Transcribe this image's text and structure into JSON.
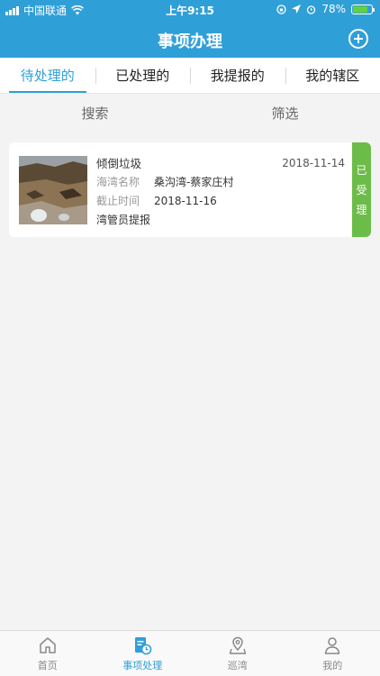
{
  "statusbar": {
    "carrier": "中国联通",
    "time": "上午9:15",
    "battery": "78%",
    "battery_level": 0.78
  },
  "navbar": {
    "title": "事项办理"
  },
  "tabs": [
    {
      "label": "待处理的",
      "active": true
    },
    {
      "label": "已处理的",
      "active": false
    },
    {
      "label": "我提报的",
      "active": false
    },
    {
      "label": "我的辖区",
      "active": false
    }
  ],
  "filter": {
    "search": "搜索",
    "filter": "筛选"
  },
  "items": [
    {
      "title": "倾倒垃圾",
      "date": "2018-11-14",
      "bay_label": "海湾名称",
      "bay_value": "桑沟湾-蔡家庄村",
      "deadline_label": "截止时间",
      "deadline_value": "2018-11-16",
      "reporter": "湾管员提报",
      "status_chars": [
        "已",
        "受",
        "理"
      ],
      "status_color": "#6cbc49"
    }
  ],
  "bottom_nav": [
    {
      "label": "首页",
      "icon": "home-icon"
    },
    {
      "label": "事项处理",
      "icon": "task-icon",
      "active": true
    },
    {
      "label": "巡湾",
      "icon": "location-icon"
    },
    {
      "label": "我的",
      "icon": "user-icon"
    }
  ],
  "colors": {
    "primary": "#2f9fd8",
    "status_green": "#6cbc49"
  }
}
